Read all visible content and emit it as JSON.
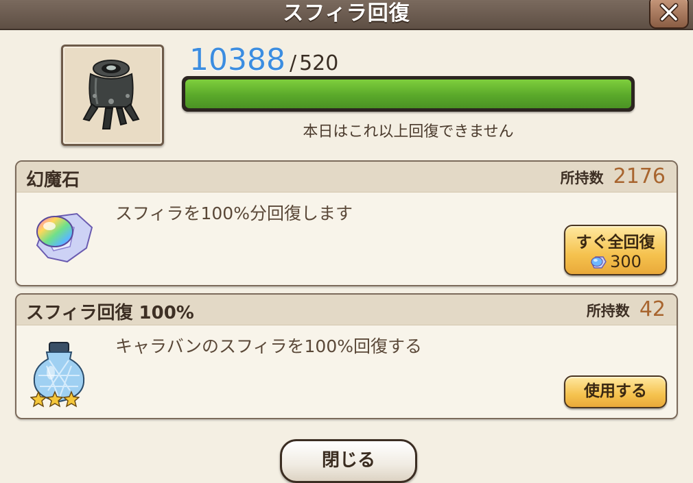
{
  "dialog": {
    "title": "スフィラ回復",
    "close_label": "閉じる"
  },
  "recovery": {
    "current": "10388",
    "separator": "/",
    "max": "520",
    "progress_fraction": 1.0,
    "status": "本日はこれ以上回復できません",
    "bar_color": "#5aa92a"
  },
  "items": [
    {
      "name": "幻魔石",
      "owned_label": "所持数",
      "owned_value": "2176",
      "description": "スフィラを100%分回復します",
      "icon": "rainbow-gem-icon",
      "button_label": "すぐ全回復",
      "button_cost": "300"
    },
    {
      "name": "スフィラ回復 100%",
      "owned_label": "所持数",
      "owned_value": "42",
      "description": "キャラバンのスフィラを100%回復する",
      "icon": "potion-vase-icon",
      "rarity_stars": 3,
      "button_label": "使用する"
    }
  ],
  "colors": {
    "current_value": "#3c8de0",
    "owned_value": "#a8652f",
    "button_gold": "#f5c24e"
  }
}
